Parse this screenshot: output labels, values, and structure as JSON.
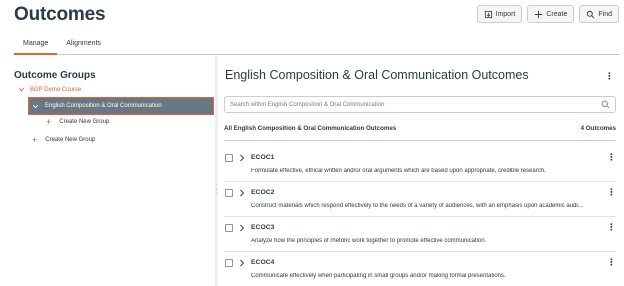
{
  "page": {
    "title": "Outcomes"
  },
  "toolbar": {
    "import_label": "Import",
    "create_label": "Create",
    "find_label": "Find"
  },
  "tabs": [
    {
      "label": "Manage",
      "active": true
    },
    {
      "label": "Alignments",
      "active": false
    }
  ],
  "sidebar": {
    "title": "Outcome Groups",
    "course": "BGP Demo Course",
    "selected_group": "English Composition & Oral Communication",
    "create_new_inner": "Create New Group",
    "create_new_outer": "Create New Group"
  },
  "main": {
    "title": "English Composition & Oral Communication Outcomes",
    "search_placeholder": "Search within English Composition & Oral Communication",
    "list_heading": "All English Composition & Oral Communication Outcomes",
    "count": "4 Outcomes",
    "outcomes": [
      {
        "code": "ECOC1",
        "description": "Formulate effective, ethical written and/or oral arguments which are based upon appropriate, credible research."
      },
      {
        "code": "ECOC2",
        "description": "Construct materials which respond effectively to the needs of a variety of audiences, with an emphasis upon academic audi..."
      },
      {
        "code": "ECOC3",
        "description": "Analyze how the principles of rhetoric work together to promote effective communication."
      },
      {
        "code": "ECOC4",
        "description": "Communicate effectively when participating in small groups and/or making formal presentations."
      }
    ]
  },
  "colors": {
    "accent": "#e66135",
    "selected_bg": "#6b7780",
    "text": "#2d3b45",
    "border": "#c7cdd1"
  },
  "icons": [
    "import-icon",
    "plus-icon",
    "search-icon",
    "chevron-down-icon",
    "chevron-right-icon",
    "kebab-icon",
    "drag-handle-icon"
  ]
}
